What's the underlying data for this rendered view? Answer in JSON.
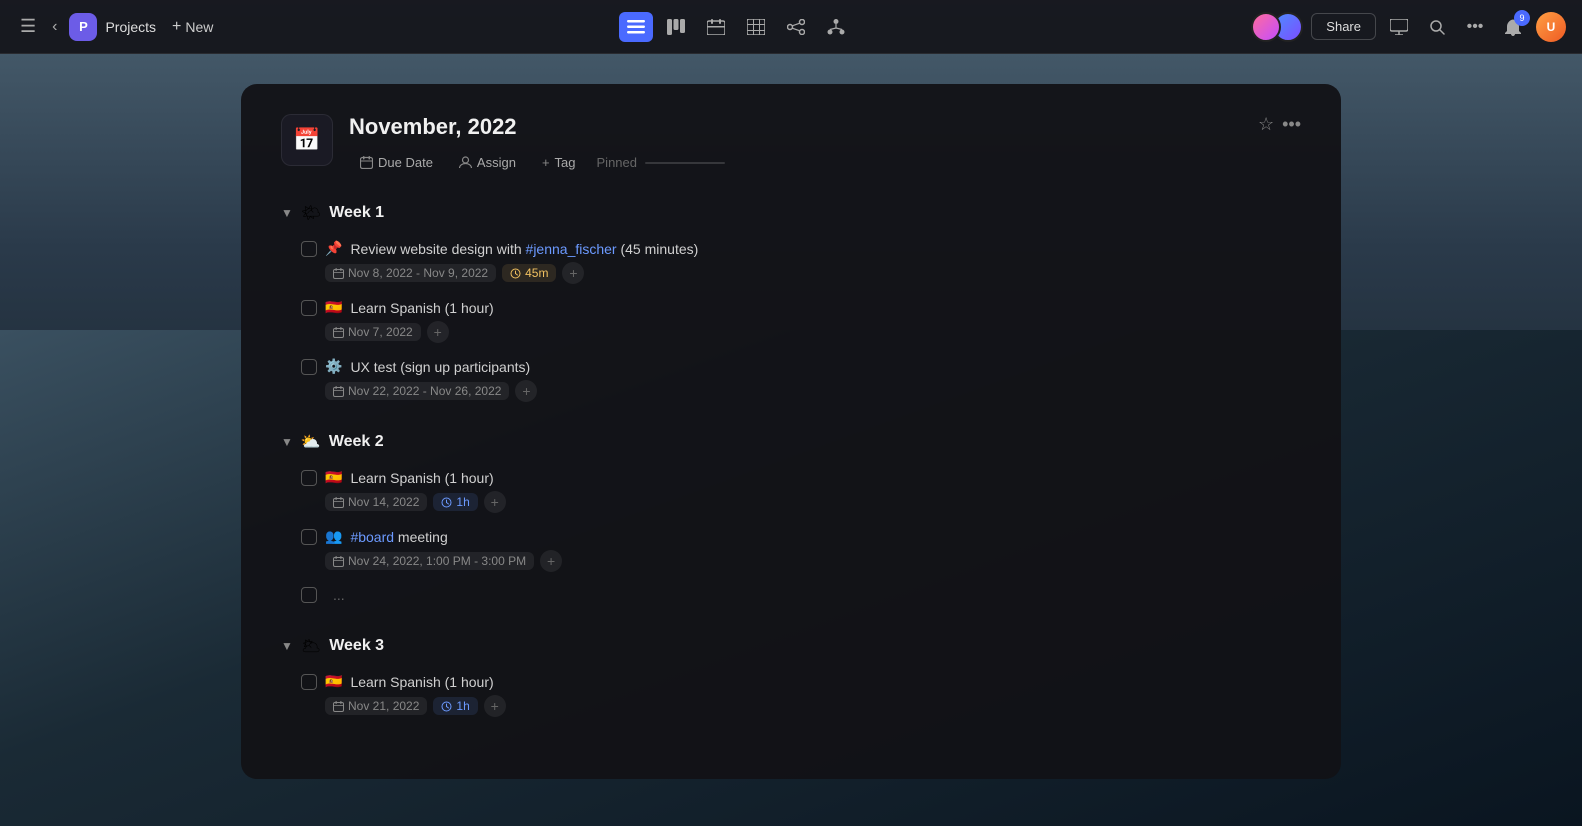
{
  "topbar": {
    "project_badge": "P",
    "projects_label": "Projects",
    "new_label": "New",
    "share_label": "Share",
    "notification_count": "9",
    "views": [
      {
        "id": "list",
        "icon": "≡",
        "active": true
      },
      {
        "id": "kanban",
        "icon": "⊞",
        "active": false
      },
      {
        "id": "calendar",
        "icon": "⊟",
        "active": false
      },
      {
        "id": "table",
        "icon": "⊡",
        "active": false
      },
      {
        "id": "share2",
        "icon": "⋈",
        "active": false
      },
      {
        "id": "hierarchy",
        "icon": "⊠",
        "active": false
      }
    ]
  },
  "project": {
    "title": "November, 2022",
    "icon": "📅",
    "toolbar": {
      "due_date_label": "Due Date",
      "assign_label": "Assign",
      "tag_label": "Tag",
      "pinned_label": "Pinned"
    },
    "weeks": [
      {
        "id": "week1",
        "title": "Week 1",
        "emoji": "🌤",
        "tasks": [
          {
            "id": "t1",
            "emoji": "📌",
            "text": "Review website design with ",
            "link_text": "#jenna_fischer",
            "text_after": " (45 minutes)",
            "meta": [
              {
                "type": "date",
                "value": "Nov 8, 2022 - Nov 9, 2022"
              },
              {
                "type": "time",
                "value": "45m",
                "style": "yellow"
              }
            ]
          },
          {
            "id": "t2",
            "emoji": "🇪🇸",
            "text": "Learn Spanish (1 hour)",
            "meta": [
              {
                "type": "date",
                "value": "Nov 7, 2022"
              }
            ]
          },
          {
            "id": "t3",
            "emoji": "⚙️",
            "text": "UX test (sign up participants)",
            "meta": [
              {
                "type": "date",
                "value": "Nov 22, 2022 - Nov 26, 2022"
              }
            ]
          }
        ]
      },
      {
        "id": "week2",
        "title": "Week 2",
        "emoji": "⛅",
        "tasks": [
          {
            "id": "t4",
            "emoji": "🇪🇸",
            "text": "Learn Spanish (1 hour)",
            "meta": [
              {
                "type": "date",
                "value": "Nov 14, 2022"
              },
              {
                "type": "time",
                "value": "1h",
                "style": "blue"
              }
            ]
          },
          {
            "id": "t5",
            "emoji": "👥",
            "text_before": "",
            "link_text": "#board",
            "text_after": " meeting",
            "meta": [
              {
                "type": "date",
                "value": "Nov 24, 2022, 1:00 PM - 3:00 PM"
              }
            ]
          },
          {
            "id": "t6",
            "emoji": "",
            "text": "...",
            "meta": []
          }
        ]
      },
      {
        "id": "week3",
        "title": "Week 3",
        "emoji": "🌥",
        "tasks": [
          {
            "id": "t7",
            "emoji": "🇪🇸",
            "text": "Learn Spanish (1 hour)",
            "meta": [
              {
                "type": "date",
                "value": "Nov 21, 2022"
              },
              {
                "type": "time",
                "value": "1h",
                "style": "blue"
              }
            ]
          }
        ]
      }
    ]
  }
}
